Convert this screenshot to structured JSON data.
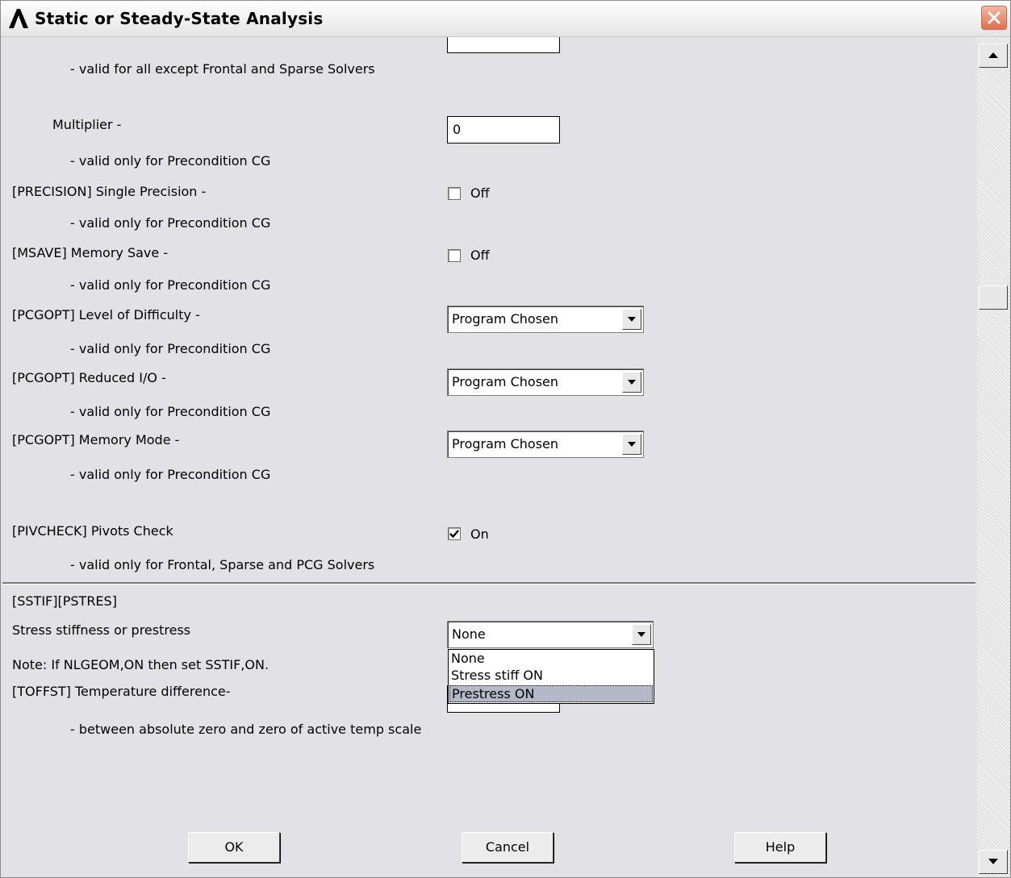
{
  "window": {
    "title": "Static or Steady-State Analysis"
  },
  "rows": {
    "note_all_except": "- valid for all except Frontal and Sparse Solvers",
    "multiplier_label": "Multiplier -",
    "multiplier_value": "0",
    "note_pcg_1": "- valid only for Precondition CG",
    "precision_label": "[PRECISION] Single Precision -",
    "precision_state": "Off",
    "note_pcg_2": "- valid only for Precondition CG",
    "msave_label": "[MSAVE]  Memory Save -",
    "msave_state": "Off",
    "note_pcg_3": "- valid only for Precondition CG",
    "pcgopt_level_label": "[PCGOPT]  Level of Difficulty -",
    "pcgopt_level_value": "Program Chosen",
    "note_pcg_4": "- valid only for Precondition CG",
    "pcgopt_io_label": "[PCGOPT]  Reduced I/O -",
    "pcgopt_io_value": "Program Chosen",
    "note_pcg_5": "- valid only for Precondition CG",
    "pcgopt_mem_label": "[PCGOPT]  Memory Mode -",
    "pcgopt_mem_value": "Program Chosen",
    "note_pcg_6": "- valid only for Precondition CG",
    "pivcheck_label": "[PIVCHECK] Pivots Check",
    "pivcheck_state": "On",
    "note_pivcheck": "- valid only for Frontal, Sparse and PCG Solvers",
    "sstif_header": "[SSTIF][PSTRES]",
    "stress_label": "Stress stiffness or prestress",
    "stress_value": "None",
    "nlgeom_note": "Note: If NLGEOM,ON then set SSTIF,ON.",
    "toffst_label": "[TOFFST] Temperature difference-",
    "toffst_note": "- between absolute zero and zero of active temp scale"
  },
  "stress_options": [
    "None",
    "Stress stiff ON",
    "Prestress    ON"
  ],
  "stress_selected_index": 2,
  "buttons": {
    "ok": "OK",
    "cancel": "Cancel",
    "help": "Help"
  },
  "colors": {
    "background": "#e1e1e6",
    "selection": "#b5b8c8"
  }
}
